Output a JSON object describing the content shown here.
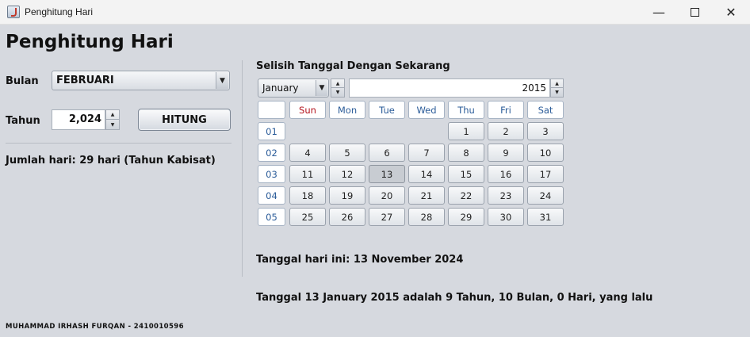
{
  "window": {
    "title": "Penghitung Hari",
    "minimize": "—",
    "close": "✕"
  },
  "app_title": "Penghitung Hari",
  "left": {
    "bulan_label": "Bulan",
    "bulan_value": "FEBRUARI",
    "tahun_label": "Tahun",
    "tahun_value": "2,024",
    "hitung_label": "HITUNG",
    "result": "Jumlah hari: 29 hari (Tahun Kabisat)"
  },
  "right": {
    "heading": "Selisih Tanggal Dengan Sekarang",
    "month_select": "January",
    "year_value": "2015",
    "weekdays": [
      "Sun",
      "Mon",
      "Tue",
      "Wed",
      "Thu",
      "Fri",
      "Sat"
    ],
    "weeks": [
      "01",
      "02",
      "03",
      "04",
      "05"
    ],
    "days": [
      [
        "",
        "",
        "",
        "",
        "1",
        "2",
        "3"
      ],
      [
        "4",
        "5",
        "6",
        "7",
        "8",
        "9",
        "10"
      ],
      [
        "11",
        "12",
        "13",
        "14",
        "15",
        "16",
        "17"
      ],
      [
        "18",
        "19",
        "20",
        "21",
        "22",
        "23",
        "24"
      ],
      [
        "25",
        "26",
        "27",
        "28",
        "29",
        "30",
        "31"
      ]
    ],
    "selected_day": "13",
    "today": "Tanggal hari ini: 13 November 2024",
    "difference": "Tanggal 13 January 2015 adalah 9 Tahun, 10 Bulan, 0 Hari, yang lalu"
  },
  "footer": "MUHAMMAD IRHASH FURQAN - 2410010596",
  "icons": {
    "dropdown": "▼",
    "spin_up": "▲",
    "spin_down": "▼"
  },
  "colors": {
    "sunday": "#b3121c",
    "weekday": "#2b5c99",
    "background": "#d6d9df"
  }
}
